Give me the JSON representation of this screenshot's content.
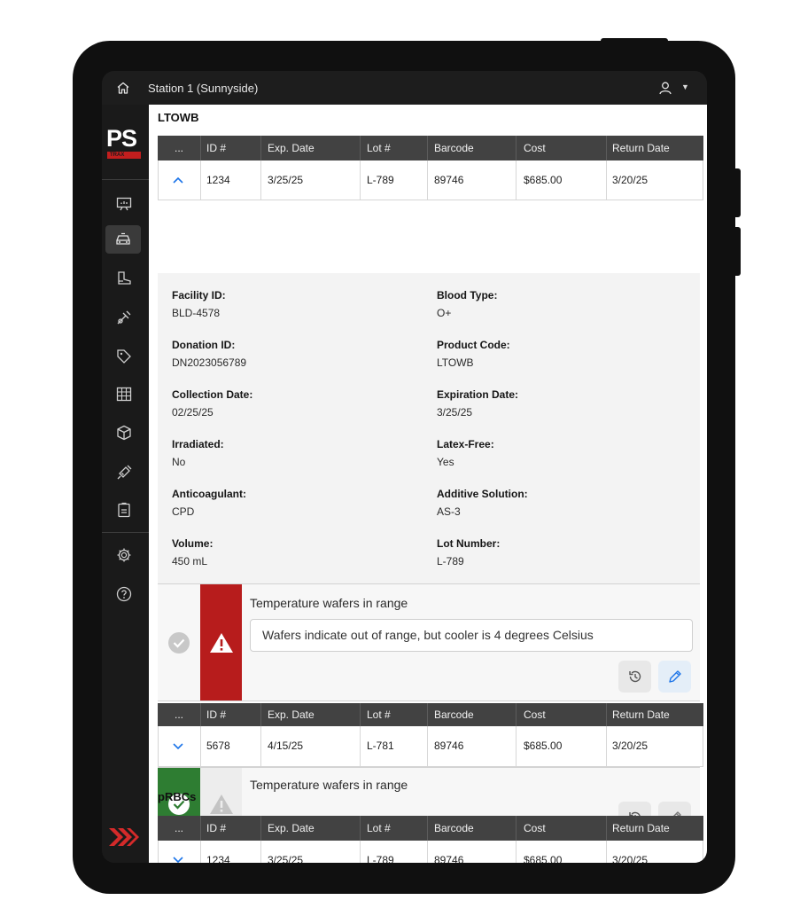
{
  "topbar": {
    "station": "Station 1 (Sunnyside)"
  },
  "logo": {
    "text": "PS",
    "subtext": "TRAX"
  },
  "sections": {
    "ltowb_title": "LTOWB",
    "prbcs_title": "pRBCs"
  },
  "columns": [
    "...",
    "ID #",
    "Exp. Date",
    "Lot #",
    "Barcode",
    "Cost",
    "Return Date"
  ],
  "rows": [
    {
      "id": "1234",
      "exp": "3/25/25",
      "lot": "L-789",
      "barcode": "89746",
      "cost": "$685.00",
      "return": "3/20/25"
    },
    {
      "id": "5678",
      "exp": "4/15/25",
      "lot": "L-781",
      "barcode": "89746",
      "cost": "$685.00",
      "return": "3/20/25"
    },
    {
      "id": "1234",
      "exp": "3/25/25",
      "lot": "L-789",
      "barcode": "89746",
      "cost": "$685.00",
      "return": "3/20/25"
    }
  ],
  "details": {
    "facility_label": "Facility ID:",
    "facility_value": "BLD-4578",
    "blood_label": "Blood Type:",
    "blood_value": "O+",
    "donation_label": "Donation ID:",
    "donation_value": "DN2023056789",
    "product_label": "Product Code:",
    "product_value": "LTOWB",
    "collection_label": "Collection Date:",
    "collection_value": "02/25/25",
    "expiration_label": "Expiration Date:",
    "expiration_value": "3/25/25",
    "irradiated_label": "Irradiated:",
    "irradiated_value": "No",
    "latex_label": "Latex-Free:",
    "latex_value": "Yes",
    "anticoag_label": "Anticoagulant:",
    "anticoag_value": "CPD",
    "additive_label": "Additive Solution:",
    "additive_value": "AS-3",
    "volume_label": "Volume:",
    "volume_value": "450 mL",
    "lotnum_label": "Lot Number:",
    "lotnum_value": "L-789"
  },
  "check1": {
    "title": "Temperature wafers in range",
    "note": "Wafers indicate out of range, but cooler is 4 degrees Celsius",
    "status": "warning"
  },
  "check2": {
    "title": "Temperature wafers in range",
    "status": "ok"
  },
  "colors": {
    "warning": "#b71c1c",
    "ok": "#2e7d32",
    "header": "#424242",
    "accent": "#1a73e8"
  }
}
